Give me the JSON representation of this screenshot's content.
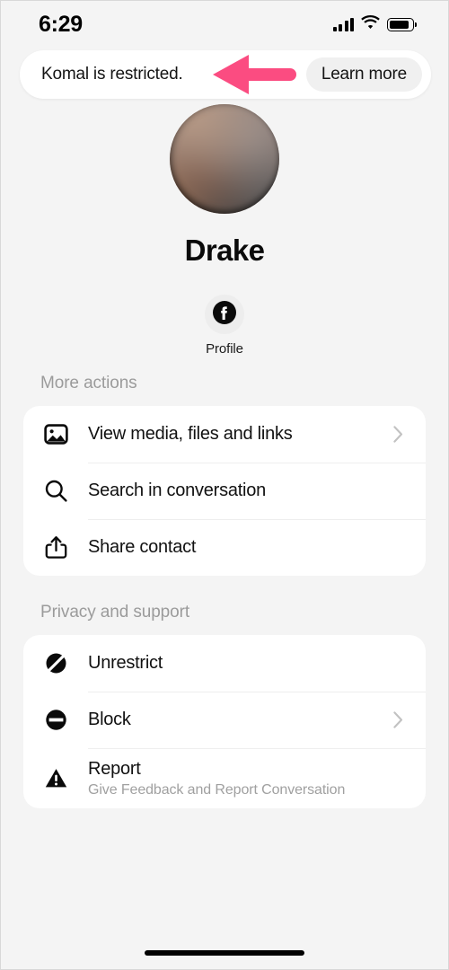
{
  "status_bar": {
    "time": "6:29",
    "signal_icon": "cellular-signal-icon",
    "wifi_icon": "wifi-icon",
    "battery_icon": "battery-icon"
  },
  "banner": {
    "message": "Komal is restricted.",
    "action_label": "Learn more",
    "annotation_arrow_color": "#fb4c81"
  },
  "profile": {
    "avatar_alt": "profile-photo",
    "name": "Drake",
    "quick_actions": [
      {
        "icon": "facebook-icon",
        "label": "Profile"
      }
    ]
  },
  "sections": [
    {
      "title": "More actions",
      "rows": [
        {
          "icon": "photo-icon",
          "title": "View media, files and links",
          "subtitle": "",
          "chevron": true
        },
        {
          "icon": "search-icon",
          "title": "Search in conversation",
          "subtitle": "",
          "chevron": false
        },
        {
          "icon": "share-icon",
          "title": "Share contact",
          "subtitle": "",
          "chevron": false
        }
      ]
    },
    {
      "title": "Privacy and support",
      "rows": [
        {
          "icon": "restrict-slash-icon",
          "title": "Unrestrict",
          "subtitle": "",
          "chevron": false
        },
        {
          "icon": "block-icon",
          "title": "Block",
          "subtitle": "",
          "chevron": true
        },
        {
          "icon": "warning-triangle-icon",
          "title": "Report",
          "subtitle": "Give Feedback and Report Conversation",
          "chevron": false
        }
      ]
    }
  ],
  "home_indicator": "home-indicator",
  "colors": {
    "background": "#f4f4f4",
    "card": "#ffffff",
    "section_title": "#9b9b9b",
    "accent_pink": "#fb4c81"
  }
}
